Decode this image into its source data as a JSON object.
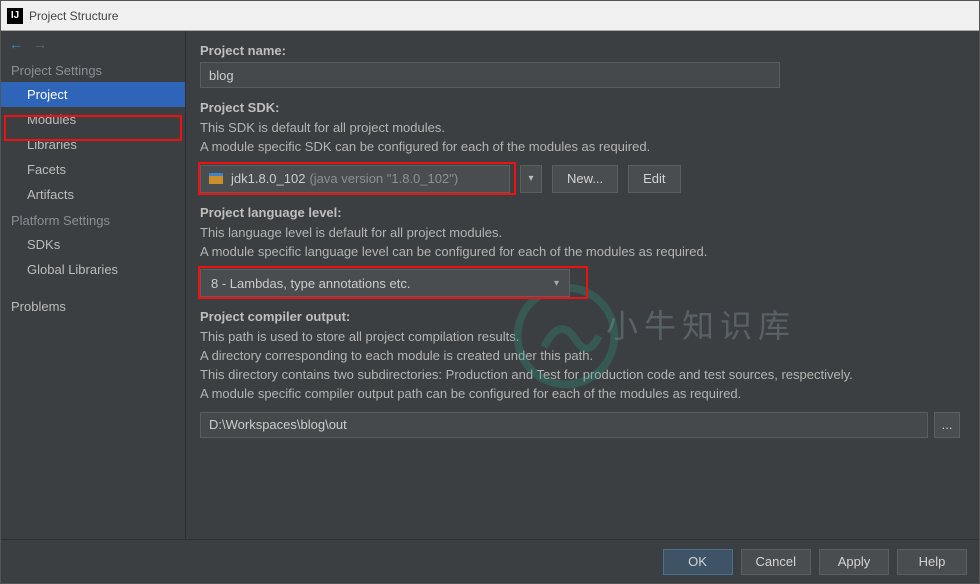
{
  "window": {
    "title": "Project Structure"
  },
  "sidebar": {
    "sections": {
      "project_settings": "Project Settings",
      "platform_settings": "Platform Settings"
    },
    "items": {
      "project": "Project",
      "modules": "Modules",
      "libraries": "Libraries",
      "facets": "Facets",
      "artifacts": "Artifacts",
      "sdks": "SDKs",
      "global_libraries": "Global Libraries",
      "problems": "Problems"
    }
  },
  "project": {
    "name_label": "Project name:",
    "name_value": "blog",
    "sdk_label": "Project SDK:",
    "sdk_desc1": "This SDK is default for all project modules.",
    "sdk_desc2": "A module specific SDK can be configured for each of the modules as required.",
    "sdk_value": "jdk1.8.0_102",
    "sdk_version": "(java version \"1.8.0_102\")",
    "new_btn": "New...",
    "edit_btn": "Edit",
    "lang_label": "Project language level:",
    "lang_desc1": "This language level is default for all project modules.",
    "lang_desc2": "A module specific language level can be configured for each of the modules as required.",
    "lang_value": "8 - Lambdas, type annotations etc.",
    "out_label": "Project compiler output:",
    "out_desc1": "This path is used to store all project compilation results.",
    "out_desc2": "A directory corresponding to each module is created under this path.",
    "out_desc3": "This directory contains two subdirectories: Production and Test for production code and test sources, respectively.",
    "out_desc4": "A module specific compiler output path can be configured for each of the modules as required.",
    "out_value": "D:\\Workspaces\\blog\\out",
    "browse": "..."
  },
  "footer": {
    "ok": "OK",
    "cancel": "Cancel",
    "apply": "Apply",
    "help": "Help"
  },
  "watermark": "小牛知识库"
}
